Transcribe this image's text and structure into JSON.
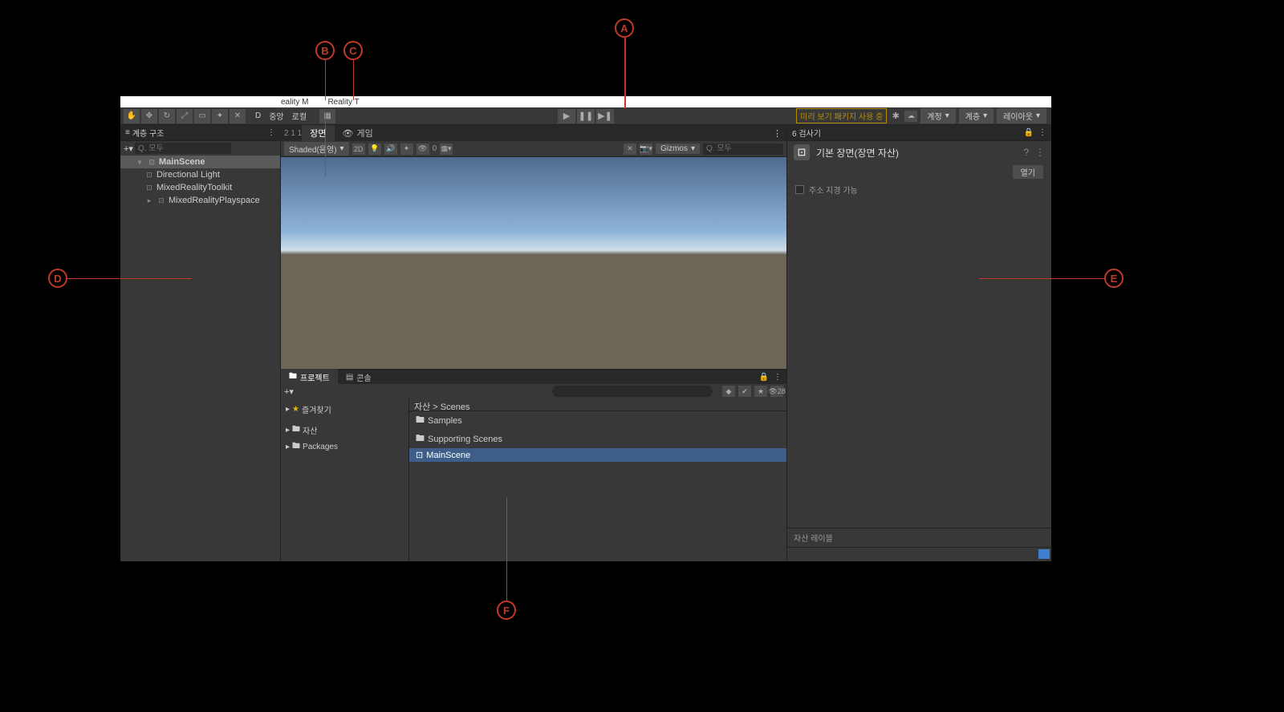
{
  "menu": {
    "reality": "eality M",
    "reality2": "Reality T"
  },
  "toolbar": {
    "pivot": "중앙",
    "local": "로컬",
    "d_prefix": "D",
    "preview": "미리 보기 패키지 사용 중",
    "account": "계정",
    "layers": "계층",
    "layout": "레이아웃"
  },
  "hierarchy": {
    "tab": "계층 구조",
    "search": "Q. 모두",
    "scene": "MainScene",
    "items": [
      "Directional Light",
      "MixedRealityToolkit",
      "MixedRealityPlayspace"
    ]
  },
  "sceneView": {
    "tabScene": "장면",
    "tabGame": "게임",
    "tabNum": "2 1 1",
    "shaded": "Shaded(음영)",
    "mode2d": "2D",
    "gizmos": "Gizmos",
    "search": "Q. 모두",
    "zero": "0"
  },
  "project": {
    "tabProject": "프로젝트",
    "tabConsole": "콘솔",
    "favorites": "즐겨찾기",
    "assets": "자산",
    "packages": "Packages",
    "breadcrumb": "자산 > Scenes",
    "files": [
      "Samples",
      "Supporting Scenes",
      "MainScene"
    ],
    "hidden": "28"
  },
  "inspector": {
    "tab": "6 검사기",
    "title": "기본 장면(장면 자산)",
    "open": "열기",
    "addressable": "주소 지경 가능",
    "assetLabels": "자산 레이블"
  },
  "callouts": {
    "A": "A",
    "B": "B",
    "C": "C",
    "D": "D",
    "E": "E",
    "F": "F"
  }
}
